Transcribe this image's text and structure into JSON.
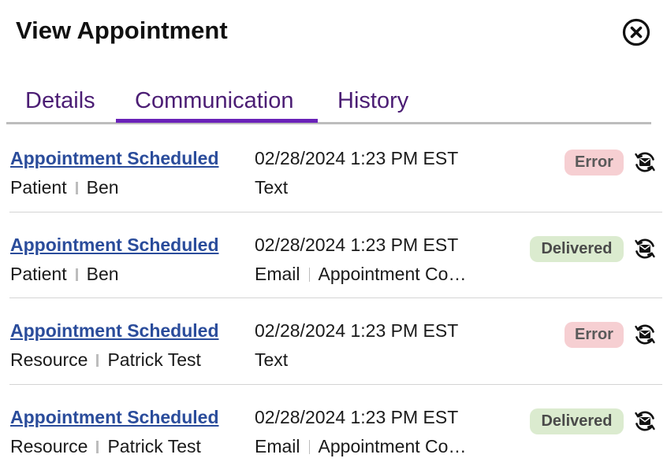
{
  "header": {
    "title": "View Appointment",
    "close_icon": "close-circle-icon"
  },
  "tabs": [
    {
      "label": "Details",
      "active": false
    },
    {
      "label": "Communication",
      "active": true
    },
    {
      "label": "History",
      "active": false
    }
  ],
  "colors": {
    "tab_text": "#4b1d74",
    "tab_active_underline": "#6a22b8",
    "link": "#2a4c9b",
    "error_badge_bg": "#f6cfd2",
    "delivered_badge_bg": "#dbebcf"
  },
  "rows": [
    {
      "title": "Appointment Scheduled",
      "recipient_type": "Patient",
      "recipient_name": "Ben",
      "datetime": "02/28/2024 1:23 PM EST",
      "channel": "Text",
      "detail": "",
      "status": "Error",
      "action_icon": "resend-envelope-icon"
    },
    {
      "title": "Appointment Scheduled",
      "recipient_type": "Patient",
      "recipient_name": "Ben",
      "datetime": "02/28/2024 1:23 PM EST",
      "channel": "Email",
      "detail": "Appointment Co…",
      "status": "Delivered",
      "action_icon": "resend-envelope-icon"
    },
    {
      "title": "Appointment Scheduled",
      "recipient_type": "Resource",
      "recipient_name": "Patrick Test",
      "datetime": "02/28/2024 1:23 PM EST",
      "channel": "Text",
      "detail": "",
      "status": "Error",
      "action_icon": "resend-envelope-icon"
    },
    {
      "title": "Appointment Scheduled",
      "recipient_type": "Resource",
      "recipient_name": "Patrick Test",
      "datetime": "02/28/2024 1:23 PM EST",
      "channel": "Email",
      "detail": "Appointment Co…",
      "status": "Delivered",
      "action_icon": "resend-envelope-icon"
    }
  ]
}
